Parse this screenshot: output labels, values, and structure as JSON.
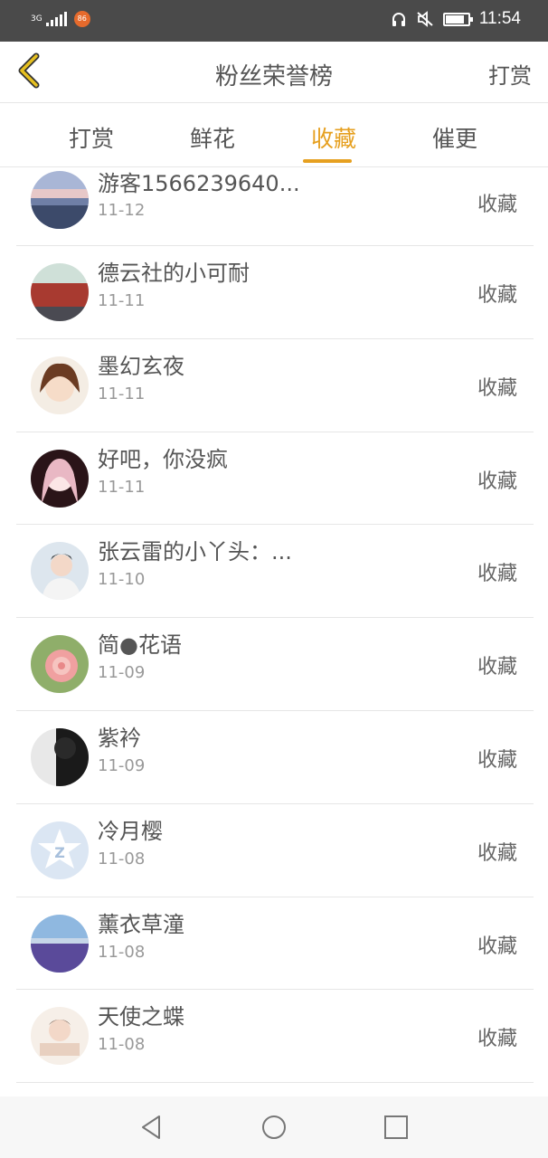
{
  "status_bar": {
    "network": "3G",
    "time": "11:54",
    "battery_level": 0.85,
    "app_badge": "86"
  },
  "header": {
    "title": "粉丝荣誉榜",
    "right_action": "打赏"
  },
  "tabs": [
    {
      "label": "打赏",
      "active": false
    },
    {
      "label": "鲜花",
      "active": false
    },
    {
      "label": "收藏",
      "active": true
    },
    {
      "label": "催更",
      "active": false
    }
  ],
  "list": [
    {
      "name": "游客1566239640...",
      "date": "11-12",
      "action": "收藏"
    },
    {
      "name": "德云社的小可耐",
      "date": "11-11",
      "action": "收藏"
    },
    {
      "name": "墨幻玄夜",
      "date": "11-11",
      "action": "收藏"
    },
    {
      "name": "好吧，你没疯",
      "date": "11-11",
      "action": "收藏"
    },
    {
      "name": "张云雷的小丫头：...",
      "date": "11-10",
      "action": "收藏"
    },
    {
      "name": "简●花语",
      "date": "11-09",
      "action": "收藏"
    },
    {
      "name": "紫衿",
      "date": "11-09",
      "action": "收藏"
    },
    {
      "name": "冷月樱",
      "date": "11-08",
      "action": "收藏"
    },
    {
      "name": "薰衣草潼",
      "date": "11-08",
      "action": "收藏"
    },
    {
      "name": "天使之蝶",
      "date": "11-08",
      "action": "收藏"
    }
  ],
  "colors": {
    "accent": "#e6a020",
    "status_bar_bg": "#4a4a4a",
    "text": "#555555",
    "subtext": "#999999"
  }
}
